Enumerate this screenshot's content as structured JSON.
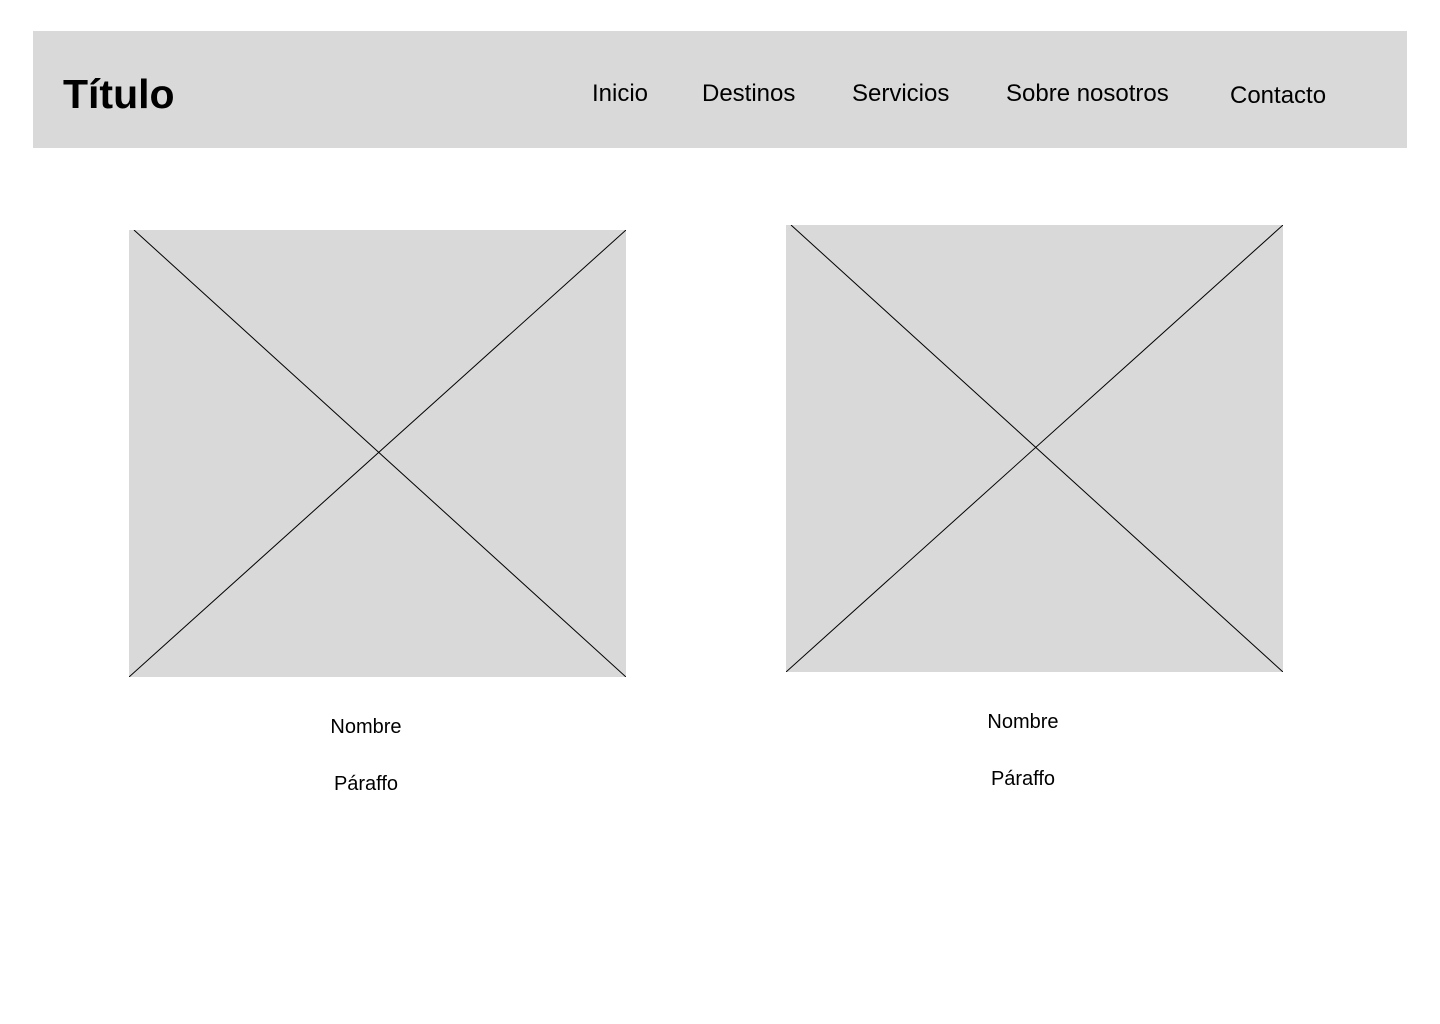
{
  "header": {
    "title": "Título",
    "nav": [
      {
        "label": "Inicio"
      },
      {
        "label": "Destinos"
      },
      {
        "label": "Servicios"
      },
      {
        "label": "Sobre nosotros"
      },
      {
        "label": "Contacto"
      }
    ]
  },
  "cards": [
    {
      "name": "Nombre",
      "paragraph": "Páraffo"
    },
    {
      "name": "Nombre",
      "paragraph": "Páraffo"
    }
  ],
  "colors": {
    "placeholder_fill": "#d9d9d9",
    "header_background": "#d9d9d9",
    "text": "#000000"
  },
  "icons": {
    "image_placeholder": "image-placeholder-icon"
  }
}
